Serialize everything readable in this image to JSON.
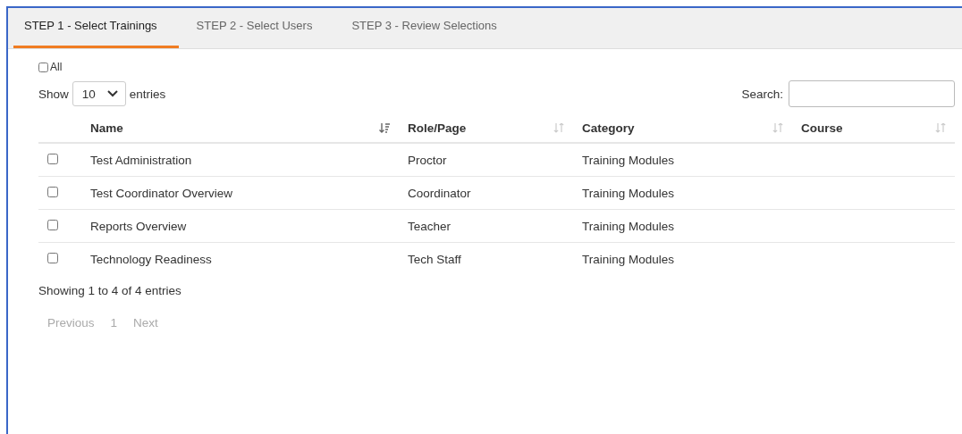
{
  "tabs": [
    {
      "label": "STEP 1 - Select Trainings",
      "selected": true
    },
    {
      "label": "STEP 2 - Select Users",
      "selected": false
    },
    {
      "label": "STEP 3 - Review Selections",
      "selected": false
    }
  ],
  "select_all": {
    "label": "All",
    "checked": false
  },
  "length": {
    "prefix": "Show",
    "value": "10",
    "suffix": "entries"
  },
  "search": {
    "label": "Search:"
  },
  "table": {
    "columns": [
      {
        "label": "Name",
        "sorted": true
      },
      {
        "label": "Role/Page",
        "sorted": false
      },
      {
        "label": "Category",
        "sorted": false
      },
      {
        "label": "Course",
        "sorted": false
      }
    ],
    "rows": [
      {
        "checked": false,
        "cells": [
          "Test Administration",
          "Proctor",
          "Training Modules",
          ""
        ]
      },
      {
        "checked": false,
        "cells": [
          "Test Coordinator Overview",
          "Coordinator",
          "Training Modules",
          ""
        ]
      },
      {
        "checked": false,
        "cells": [
          "Reports Overview",
          "Teacher",
          "Training Modules",
          ""
        ]
      },
      {
        "checked": false,
        "cells": [
          "Technology Readiness",
          "Tech Staff",
          "Training Modules",
          ""
        ]
      }
    ]
  },
  "info": "Showing 1 to 4 of 4 entries",
  "pagination": {
    "previous": "Previous",
    "page": "1",
    "next": "Next"
  }
}
